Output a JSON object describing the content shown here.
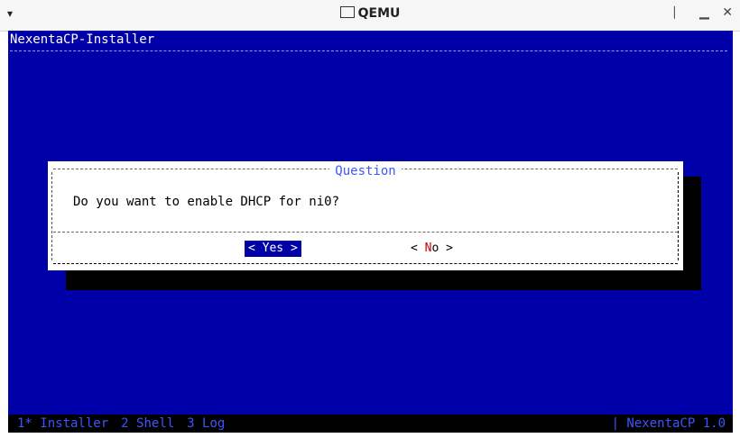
{
  "window": {
    "title": "QEMU",
    "menu_glyph": "▾",
    "controls": [
      "⎸",
      "▁",
      "✕"
    ]
  },
  "installer": {
    "header": "NexentaCP-Installer",
    "dialog": {
      "title": "Question",
      "message": "Do you want to enable DHCP for ni0?",
      "yes_label": "< Yes >",
      "no_left": "< ",
      "no_hotkey": "N",
      "no_rest": "o >"
    },
    "statusbar": {
      "tabs": [
        "1* Installer",
        "2 Shell",
        "3 Log"
      ],
      "right": "| NexentaCP 1.0"
    }
  },
  "colors": {
    "screen_bg": "#0000a8",
    "dialog_bg": "#ffffff",
    "accent": "#3d55ff"
  }
}
